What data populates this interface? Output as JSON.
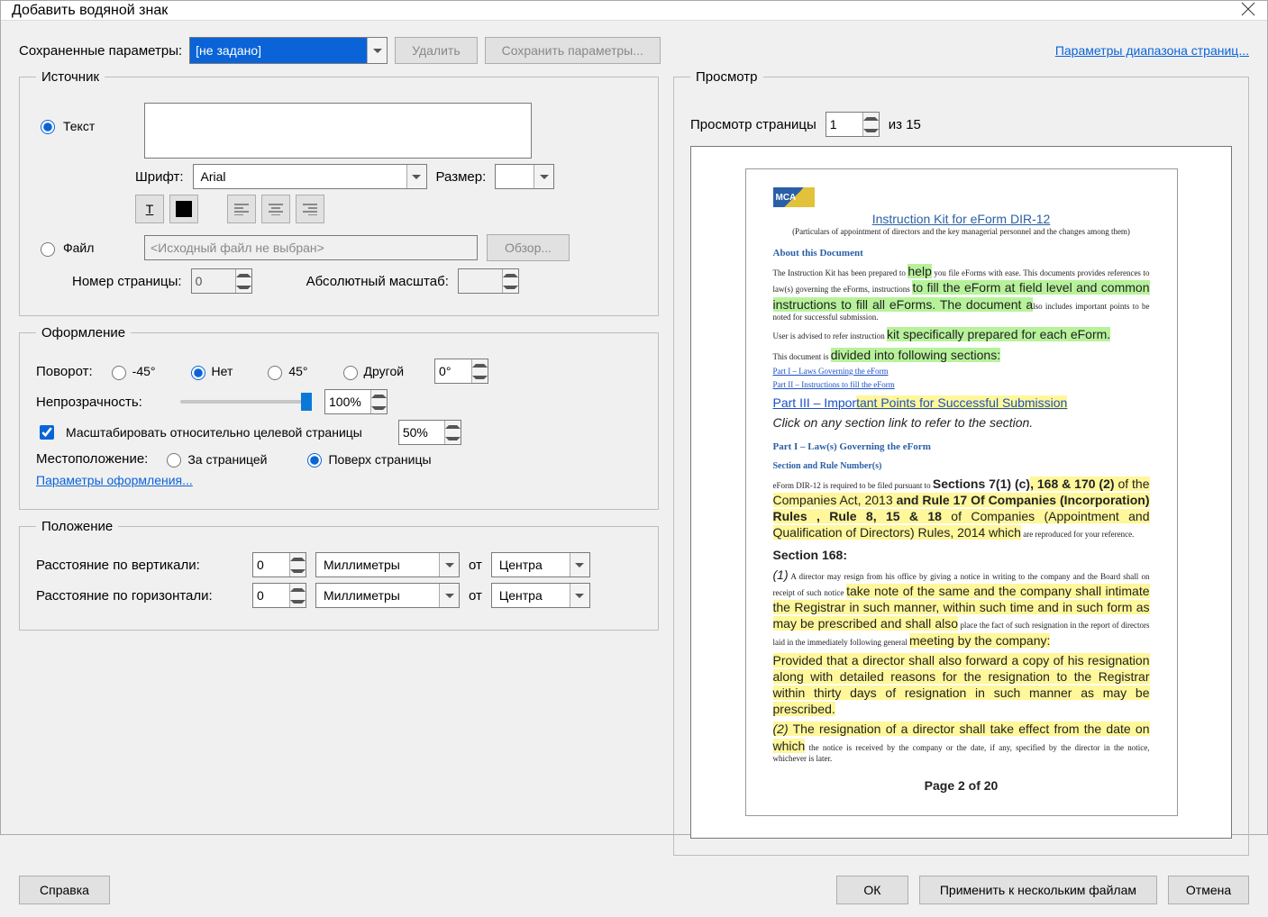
{
  "title": "Добавить водяной знак",
  "toprow": {
    "saved_label": "Сохраненные параметры:",
    "saved_value": "[не задано]",
    "delete": "Удалить",
    "save_params": "Сохранить параметры...",
    "page_range_link": "Параметры диапазона страниц..."
  },
  "source": {
    "legend": "Источник",
    "text_radio": "Текст",
    "font_label": "Шрифт:",
    "font_value": "Arial",
    "size_label": "Размер:",
    "size_value": "",
    "file_radio": "Файл",
    "file_placeholder": "<Исходный файл не выбран>",
    "browse": "Обзор...",
    "page_num_label": "Номер страницы:",
    "page_num_value": "0",
    "abs_scale_label": "Абсолютный масштаб:",
    "abs_scale_value": ""
  },
  "appearance": {
    "legend": "Оформление",
    "rotate_label": "Поворот:",
    "rot_m45": "-45°",
    "rot_none": "Нет",
    "rot_45": "45°",
    "rot_other": "Другой",
    "rot_val": "0°",
    "opacity_label": "Непрозрачность:",
    "opacity_val": "100%",
    "scale_rel_check": "Масштабировать относительно целевой страницы",
    "scale_rel_val": "50%",
    "placement_label": "Местоположение:",
    "behind": "За страницей",
    "over": "Поверх страницы",
    "appearance_link": "Параметры оформления..."
  },
  "position": {
    "legend": "Положение",
    "vdist_label": "Расстояние по вертикали:",
    "hdist_label": "Расстояние по горизонтали:",
    "val0": "0",
    "units": "Миллиметры",
    "from_label": "от",
    "from_val": "Центра"
  },
  "preview": {
    "legend": "Просмотр",
    "page_label": "Просмотр страницы",
    "page_val": "1",
    "of_label": "из 15"
  },
  "doc": {
    "logo_txt": "MCA",
    "kit_title": "Instruction Kit for eForm DIR-12",
    "kit_sub": "(Particulars of appointment of directors and the key managerial personnel and the changes among them)",
    "about_h": "About this Document",
    "about_p": "The Instruction Kit has been prepared to help you file eForms with ease. This documents provides references to law(s) governing the eForms, instructions to fill the eForm at field level and common instructions to fill all eForms. The document also includes important points to be noted for successful submission.",
    "adv": "User is advised to refer instruction kit specifically prepared for each eForm.",
    "div": "This document is divided into following sections:",
    "p1": "Part I – Laws Governing the eForm",
    "p2": "Part II – Instructions to fill the eForm",
    "p3": "Part III – Important Points for Successful Submission",
    "click": "Click on any section link to refer to the section.",
    "part1_h": "Part I – Law(s) Governing the eForm",
    "sec_rule_h": "Section and Rule Number(s)",
    "sec_rule_p": "eForm DIR-12 is required to be filed pursuant to Sections 7(1) (c), 168 & 170 (2) of the Companies Act, 2013 and Rule 17 Of Companies (Incorporation) Rules , Rule 8, 15 & 18 of Companies (Appointment and Qualification of Directors) Rules, 2014 which are reproduced for your reference.",
    "s168_h": "Section 168:",
    "s168_1": "(1) A director may resign from his office by giving a notice in writing to the company and the Board shall on receipt of such notice take note of the same and the company shall intimate the Registrar in such manner, within such time and in such form as may be prescribed and shall also place the fact of such resignation in the report of directors laid in the immediately following general meeting by the company:",
    "s168_p": "Provided that a director shall also forward a copy of his resignation along with detailed reasons for the resignation to the Registrar within thirty days of resignation in such manner as may be prescribed.",
    "s168_2": "(2) The resignation of a director shall take effect from the date on which the notice is received by the company or the date, if any, specified by the director in the notice, whichever is later.",
    "pagefoot": "Page 2 of 20"
  },
  "buttons": {
    "help": "Справка",
    "ok": "ОК",
    "apply_multi": "Применить к нескольким файлам",
    "cancel": "Отмена"
  }
}
